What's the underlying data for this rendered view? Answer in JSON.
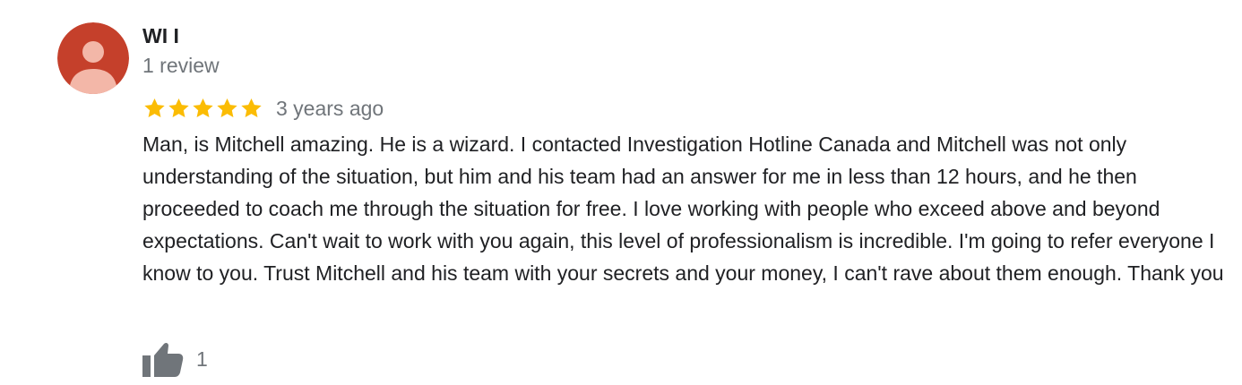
{
  "review": {
    "author": {
      "name": "WI I",
      "meta": "1 review",
      "avatar_icon": "default-user-avatar-icon",
      "avatar_color": "#c5402b",
      "avatar_figure_color": "#f3b7a8"
    },
    "rating": {
      "value": 5,
      "max": 5,
      "star_color": "#fbbc04",
      "star_icon": "star-icon"
    },
    "date": "3 years ago",
    "text": "Man, is Mitchell amazing. He is a wizard. I contacted Investigation Hotline Canada and Mitchell was not only understanding of the situation, but him and his team had an answer for me in less than 12 hours, and he then proceeded to coach me through the situation for free. I love working with people who exceed above and beyond expectations. Can't wait to work with you again, this level of professionalism is incredible. I'm going to refer everyone I know to you. Trust Mitchell and his team with your secrets and your money, I can't rave about them enough. Thank you",
    "likes": {
      "count": "1",
      "icon": "thumbs-up-icon",
      "icon_color": "#70757a"
    }
  }
}
